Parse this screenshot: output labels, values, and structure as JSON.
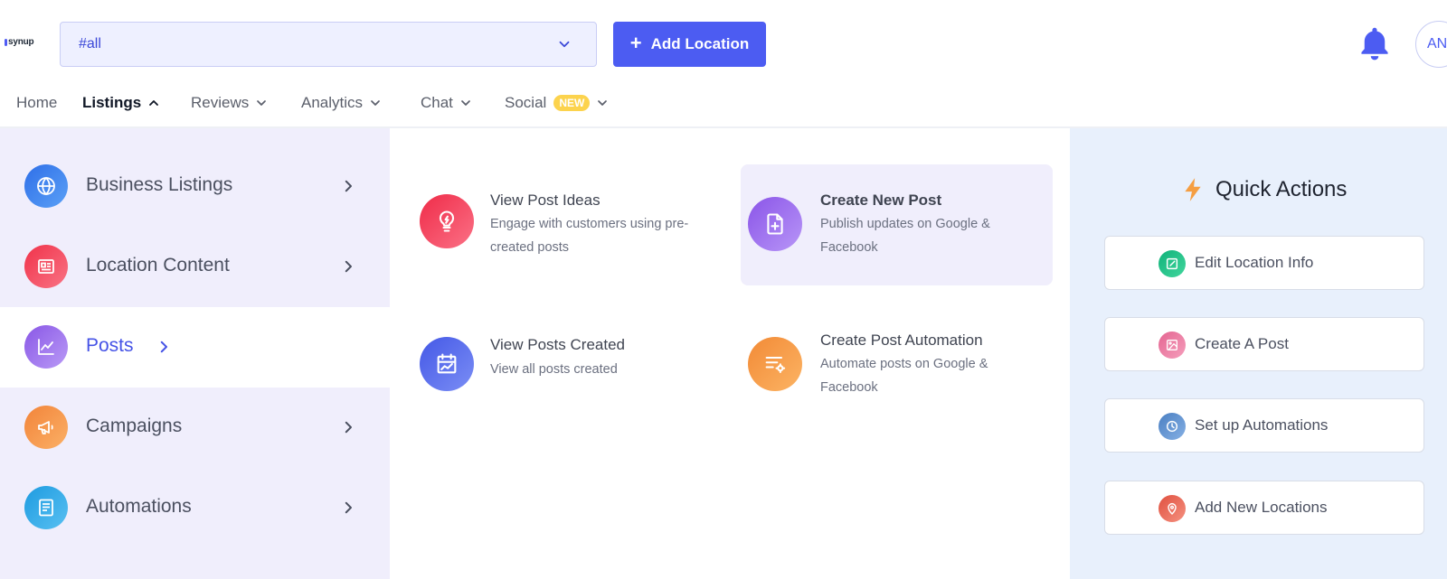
{
  "header": {
    "logo_text": "synup",
    "location_select": {
      "value": "#all"
    },
    "add_location_label": "Add Location",
    "avatar_initials": "AN"
  },
  "nav": {
    "items": [
      {
        "label": "Home"
      },
      {
        "label": "Listings"
      },
      {
        "label": "Reviews"
      },
      {
        "label": "Analytics"
      },
      {
        "label": "Chat"
      },
      {
        "label": "Social",
        "badge": "NEW"
      }
    ],
    "active": "Listings"
  },
  "categories": [
    {
      "label": "Business Listings",
      "icon": "globe-icon"
    },
    {
      "label": "Location Content",
      "icon": "id-card-icon"
    },
    {
      "label": "Posts",
      "icon": "chart-line-icon",
      "active": true
    },
    {
      "label": "Campaigns",
      "icon": "megaphone-icon"
    },
    {
      "label": "Automations",
      "icon": "document-icon"
    }
  ],
  "cards": [
    {
      "title": "View Post Ideas",
      "desc": "Engage with customers using pre-created posts",
      "icon": "lightbulb-icon"
    },
    {
      "title": "Create New Post",
      "desc": "Publish updates on Google & Facebook",
      "icon": "file-plus-icon",
      "highlight": true
    },
    {
      "title": "View Posts Created",
      "desc": "View all posts created",
      "icon": "calendar-chart-icon"
    },
    {
      "title": "Create Post Automation",
      "desc": "Automate posts on Google & Facebook",
      "icon": "list-gear-icon"
    }
  ],
  "quick_actions": {
    "title": "Quick Actions",
    "items": [
      {
        "label": "Edit Location Info",
        "icon": "edit-icon"
      },
      {
        "label": "Create A Post",
        "icon": "image-icon"
      },
      {
        "label": "Set up Automations",
        "icon": "clock-icon"
      },
      {
        "label": "Add New Locations",
        "icon": "map-pin-icon"
      }
    ]
  },
  "colors": {
    "accent": "#4c5cf2",
    "left_panel_bg": "#f0eefc",
    "right_panel_bg": "#e8f0fc",
    "badge": "#fcd34d"
  }
}
